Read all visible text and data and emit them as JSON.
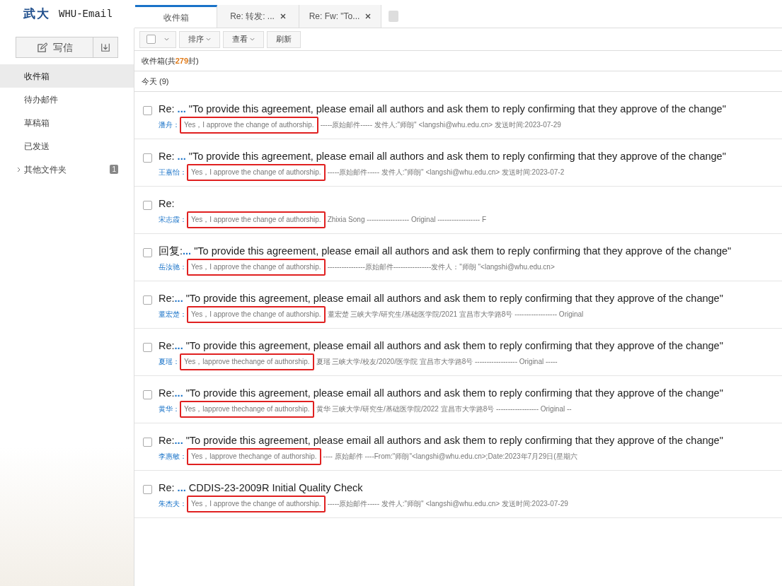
{
  "logo": {
    "mark": "武大",
    "name": "WHU-Email"
  },
  "sidebar": {
    "compose": "写信",
    "items": [
      {
        "label": "收件箱",
        "selected": true
      },
      {
        "label": "待办邮件",
        "selected": false
      },
      {
        "label": "草稿箱",
        "selected": false
      },
      {
        "label": "已发送",
        "selected": false
      },
      {
        "label": "其他文件夹",
        "selected": false,
        "expandable": true,
        "badge": "1"
      }
    ]
  },
  "tabs": [
    {
      "label": "收件箱",
      "selected": true,
      "closable": false
    },
    {
      "label": "Re: 转发: ...",
      "selected": false,
      "closable": true
    },
    {
      "label": "Re: Fw: \"To...",
      "selected": false,
      "closable": true
    }
  ],
  "toolbar": {
    "checked": false,
    "buttons": [
      {
        "label": "排序",
        "dropdown": true
      },
      {
        "label": "查看",
        "dropdown": true
      },
      {
        "label": "刷新",
        "dropdown": false
      }
    ]
  },
  "folder_summary": {
    "name": "收件箱(",
    "pre": "共",
    "count": "279",
    "post": "封)"
  },
  "group": "今天 (9)",
  "messages": [
    {
      "checked": false,
      "prefix": "Re:",
      "ellipsis": " ...",
      "subject": " \"To provide this agreement, please email all authors and ask them to reply confirming that they approve of the change\"",
      "sender": "潘舟：",
      "highlight": "Yes，I approve the change of authorship.",
      "rest": " -----原始邮件----- 发件人:\"师朗\" <langshi@whu.edu.cn> 发送时间:2023-07-29",
      "annotated": true
    },
    {
      "checked": false,
      "prefix": "Re:",
      "ellipsis": " ...",
      "subject": " \"To provide this agreement, please email all authors and ask them to reply confirming that they approve of the change\"",
      "sender": "王嘉怡：",
      "highlight": "Yes，I approve the change of authorship.",
      "rest": " -----原始邮件----- 发件人:\"师朗\" <langshi@whu.edu.cn> 发送时间:2023-07-2",
      "annotated": true
    },
    {
      "checked": false,
      "prefix": "Re:",
      "sender": "宋志霞：",
      "highlight": "Yes，I approve the change of authorship.",
      "rest": " Zhixia Song ------------------ Original ------------------ F",
      "annotated": true
    },
    {
      "checked": false,
      "prefix": "回复:",
      "ellipsis": "...",
      "subject": " \"To provide this agreement, please email all authors and ask them to reply confirming that they approve of the change\"",
      "sender": "岳汝驰：",
      "highlight": "Yes，I approve the change of authorship.",
      "rest": "----------------原始邮件----------------发件人：\"师朗 \"<langshi@whu.edu.cn>",
      "annotated": true
    },
    {
      "checked": false,
      "prefix": "Re:",
      "ellipsis": "...",
      "subject": " \"To provide this agreement, please email all authors and ask them to reply confirming that they approve of the change\"",
      "sender": "董宏楚：",
      "highlight": "Yes，I approve the change of authorship.",
      "rest": " 董宏楚 三峡大学/研究生/基础医学院/2021 宜昌市大学路8号 ------------------ Original",
      "annotated": true
    },
    {
      "checked": false,
      "prefix": "Re:",
      "ellipsis": "...",
      "subject": " \"To provide this agreement, please email all authors and ask them to reply confirming that they approve of the change\"",
      "sender": "夏瑶：",
      "highlight": "Yes，lapprove thechange of authorship.",
      "rest": " 夏瑶 三峡大学/校友/2020/医学院 宜昌市大学路8号 ------------------ Original -----",
      "annotated": true
    },
    {
      "checked": false,
      "prefix": "Re:",
      "ellipsis": "...",
      "subject": " \"To provide this agreement, please email all authors and ask them to reply confirming that they approve of the change\"",
      "sender": "黄华：",
      "highlight": "Yes，lapprove thechange of authorship.",
      "rest": " 黄华 三峡大学/研究生/基础医学院/2022 宜昌市大学路8号 ------------------ Original --",
      "annotated": true
    },
    {
      "checked": false,
      "prefix": "Re:",
      "ellipsis": "...",
      "subject": " \"To provide this agreement, please email all authors and ask them to reply confirming that they approve of the change\"",
      "sender": "李惠敏：",
      "highlight": "Yes，lapprove thechange of authorship.",
      "rest": "---- 原始邮件 ----From:\"师朗\"<langshi@whu.edu.cn>;Date:2023年7月29日(星期六",
      "annotated": true
    },
    {
      "checked": false,
      "prefix": "Re:",
      "ellipsis": " ...",
      "subject": " CDDIS-23-2009R Initial Quality Check",
      "sender": "朱杰夫：",
      "highlight": "Yes，I approve the change of authorship.",
      "rest": " -----原始邮件----- 发件人:\"师朗\" <langshi@whu.edu.cn> 发送时间:2023-07-29",
      "annotated": true
    }
  ]
}
